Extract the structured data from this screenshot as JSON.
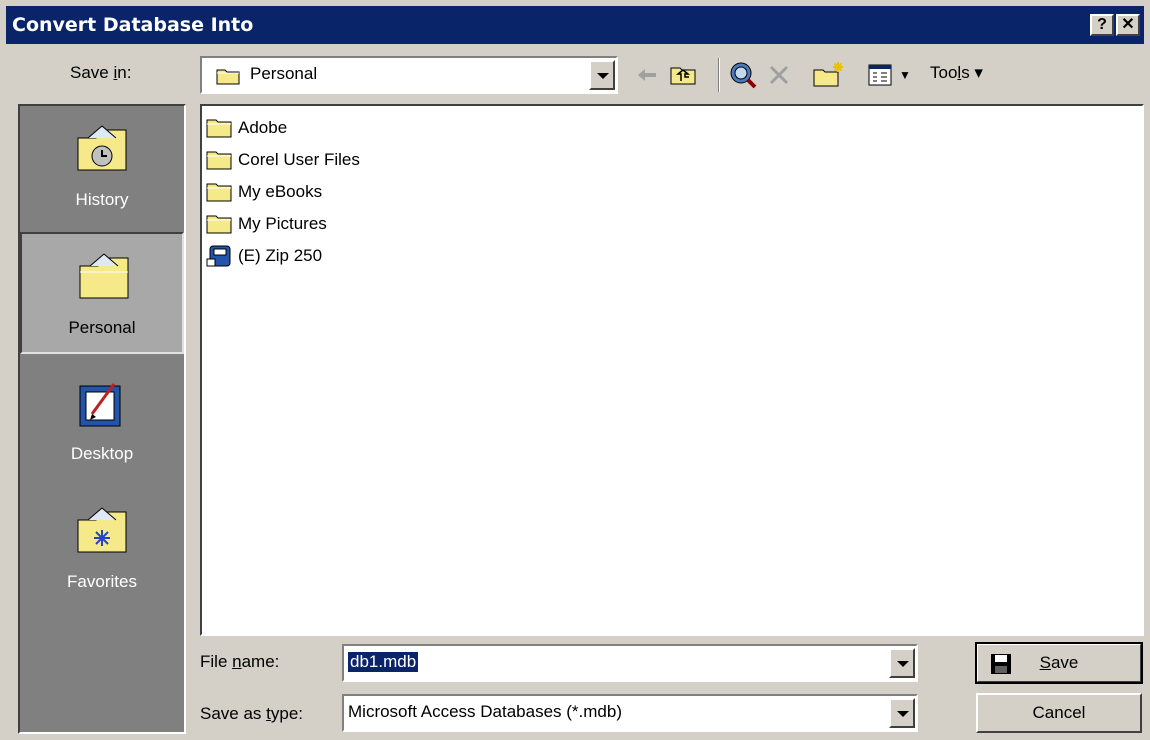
{
  "window": {
    "title": "Convert Database Into",
    "help_glyph": "?",
    "close_glyph": "✕"
  },
  "save_in": {
    "label_pre": "Save ",
    "label_key": "i",
    "label_post": "n:",
    "value": "Personal"
  },
  "toolbar": {
    "tools_pre": "Too",
    "tools_key": "l",
    "tools_post": "s ▾"
  },
  "places": [
    {
      "label": "History",
      "icon": "history-folder-icon"
    },
    {
      "label": "Personal",
      "icon": "personal-folder-icon"
    },
    {
      "label": "Desktop",
      "icon": "desktop-icon"
    },
    {
      "label": "Favorites",
      "icon": "favorites-folder-icon"
    }
  ],
  "files": [
    {
      "name": "Adobe",
      "icon": "folder-icon"
    },
    {
      "name": "Corel User Files",
      "icon": "folder-icon"
    },
    {
      "name": "My eBooks",
      "icon": "folder-icon"
    },
    {
      "name": "My Pictures",
      "icon": "folder-icon"
    },
    {
      "name": "(E) Zip 250",
      "icon": "zip-drive-icon"
    }
  ],
  "file_name": {
    "label_pre": "File ",
    "label_key": "n",
    "label_post": "ame:",
    "value": "db1.mdb"
  },
  "save_as_type": {
    "label_pre": "Save as ",
    "label_key": "t",
    "label_post": "ype:",
    "value": "Microsoft Access Databases (*.mdb)"
  },
  "buttons": {
    "save_key": "S",
    "save_rest": "ave",
    "cancel": "Cancel"
  },
  "colors": {
    "titlebar": "#0a246a",
    "face": "#d4d0c8",
    "places_bg": "#808080",
    "selection": "#0a246a"
  }
}
